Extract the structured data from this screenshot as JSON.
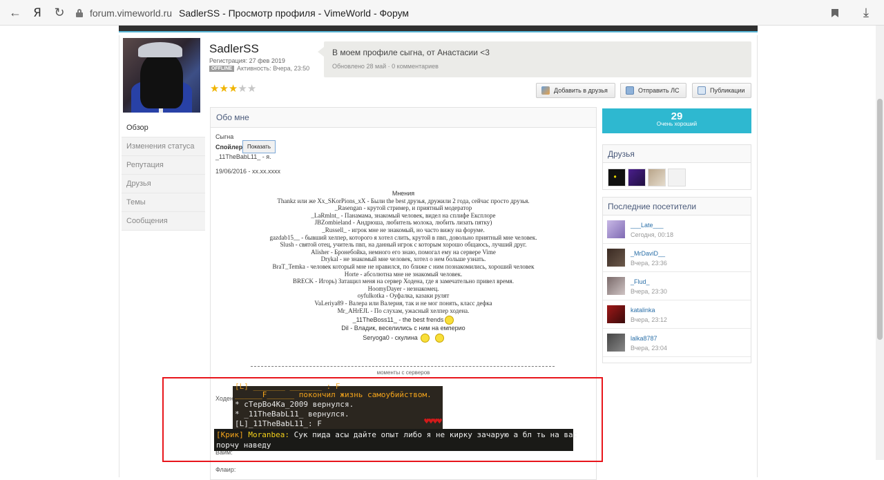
{
  "browser": {
    "back_glyph": "←",
    "ya_label": "Я",
    "reload_glyph": "↻",
    "domain": "forum.vimeworld.ru",
    "page_title": "SadlerSS - Просмотр профиля - VimeWorld - Форум",
    "download_glyph": "⤓"
  },
  "profile": {
    "username": "SadlerSS",
    "registration": "Регистрация: 27 фев 2019",
    "offline_badge": "OFFLINE",
    "activity": "Активность: Вчера, 23:50",
    "stars_on": 3,
    "stars_total": 5,
    "star_glyph": "★"
  },
  "status": {
    "text": "В моем профиле сыгна, от Анастасии <3",
    "meta": "Обновлено 28 май · 0 комментариев"
  },
  "actions": {
    "add_friend": "Добавить в друзья",
    "send_pm": "Отправить ЛС",
    "posts": "Публикации"
  },
  "left_nav": {
    "items": [
      "Обзор",
      "Изменения статуса",
      "Репутация",
      "Друзья",
      "Темы",
      "Сообщения"
    ]
  },
  "about": {
    "title": "Обо мне",
    "line1": "Сыгна",
    "spoiler_label": "Спойлер",
    "spoiler_button": "Показать",
    "line2": "_11TheBabL11_ - я.",
    "date_line": "19/06/2016 - xx.xx.xxxx",
    "opinions_title": "Мнения",
    "opinions": [
      "Thankz или же Xx_SKorPions_xX - Были the best друзья, дружили 2 года, сейчас просто друзья.",
      "_Rasengan - крутой стример, и приятный модератор",
      "_LaRmlnt_ - Панамама, знакомый человек, видел на сплифе Експлоре",
      "JBZombieland - Андрюша, любитель молока, любить лизать пятку)",
      "_Russell_ - игрок мне не знакомый, но часто вижу на форуме.",
      "gazdab15__ - бывший хелпер, которого я хотел слить, крутой в пвп, довольно приятный мне человек.",
      "Slush - святой отец, учитель пвп, на данный игрок с которым хорошо общаюсь, лучший друг.",
      "Alisher - Бронебойка, немного его знаю, помогал ему на сервере Vime",
      "Drykal - не знакомый мне человек, хотел о нем больше узнать.",
      "BraT_Temka - человек который мне не нравился, по ближе с ним познакомились, хороший человек",
      "Horte - абсолютна мне не знакомый человек.",
      "BRECK - Игорь) Затащил меня на сервер Ходена, где я замечательно привел время.",
      "HoomyDayer - незнакомец.",
      "oyfulkotka - Оуфалка, казаки рулят",
      "VaLeriya89 - Валера или Валерия, так и не мог понять, класс дефка",
      "Mr_AHrEJL - По слухам, ужасный хелпер ходена."
    ],
    "boss_line": "_11TheBoss11_ - the best frends",
    "dil_line": "Dil - Владик, веселились с ним на емперио",
    "seryoga_line": "Seryoga0 - скулина",
    "moments": "моменты с серверов",
    "label_hoden": "Ходен:",
    "label_vime": "Вайм:",
    "label_flair": "Флаир:"
  },
  "chat": {
    "line0": "[L] _______ _______ : F",
    "line1": "______F______ покончил жизнь самоубийством.",
    "line2": "* cTepBo4Ka_2009  вернулся.",
    "line3": "* _11TheBabL11_  вернулся.",
    "line4": "[L]_11TheBabL11_: F",
    "hearts": "♥♥♥♥",
    "shout_tag": "[Крик]",
    "shout_user": "Moranbea:",
    "shout_text": "Сук  пида асы дайте опыт либо я не кирку зачарую а бл ть на вас",
    "shout_text2": "порчу наведу"
  },
  "reputation": {
    "value": "29",
    "label": "Очень хороший"
  },
  "friends": {
    "title": "Друзья"
  },
  "visitors": {
    "title": "Последние посетители",
    "items": [
      {
        "name": "___Late___",
        "time": "Сегодня, 00:18"
      },
      {
        "name": "_MrDaviD__",
        "time": "Вчера, 23:36"
      },
      {
        "name": "_Flud_",
        "time": "Вчера, 23:30"
      },
      {
        "name": "katalinka",
        "time": "Вчера, 23:12"
      },
      {
        "name": "lalka8787",
        "time": "Вчера, 23:04"
      }
    ]
  },
  "colors": {
    "accent": "#2eb8d0",
    "chat_orange": "#f4a41b",
    "alert_red": "#e8141a"
  }
}
